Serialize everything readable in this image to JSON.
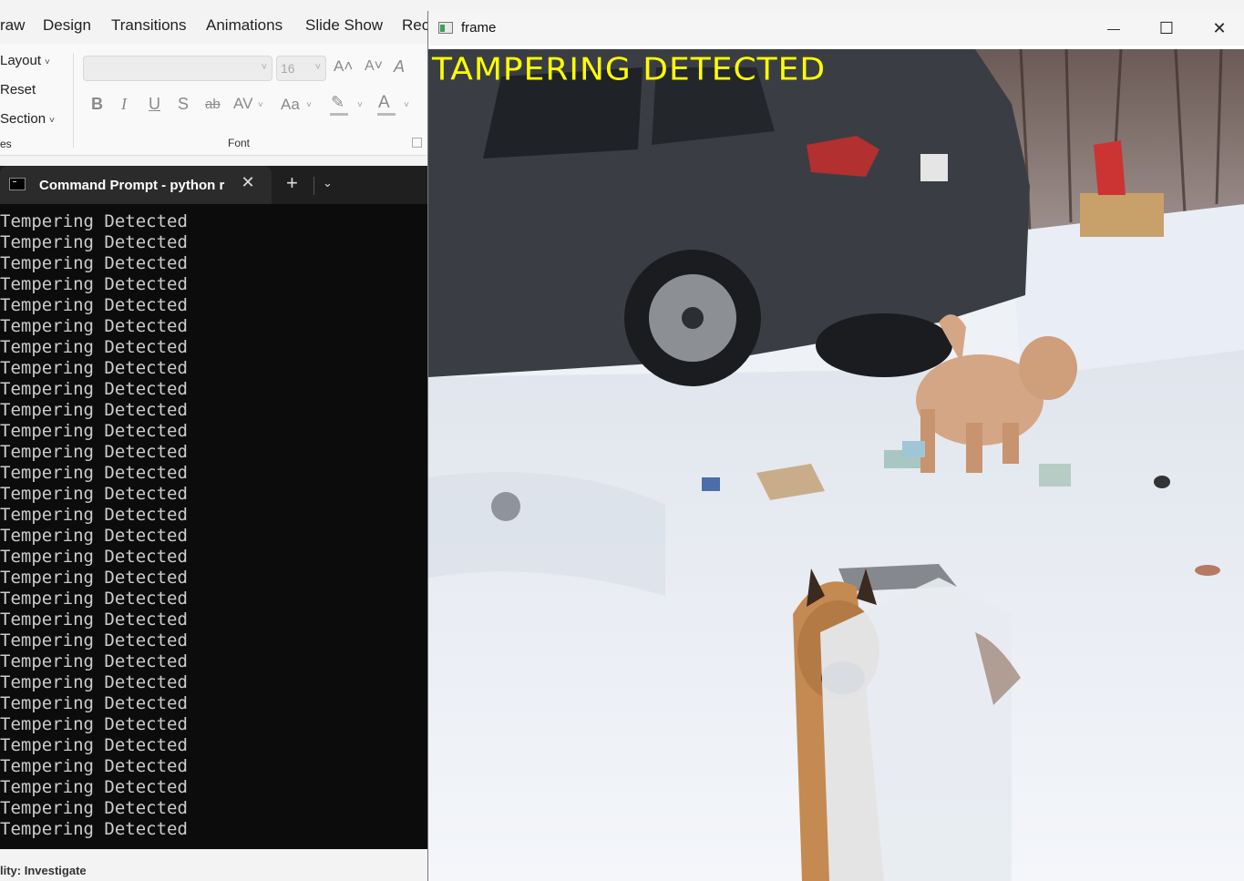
{
  "ppt": {
    "tabs": [
      "raw",
      "Design",
      "Transitions",
      "Animations",
      "Slide Show",
      "Rec"
    ],
    "slides_group": {
      "layout": "Layout",
      "reset": "Reset",
      "section": "Section",
      "group_label": "es"
    },
    "font_group": {
      "font_name": "",
      "font_size": "16",
      "grow_font": "A˄",
      "shrink_font": "A˅",
      "clear_formatting": "A",
      "bold": "B",
      "italic": "I",
      "underline": "U",
      "shadow": "S",
      "strikethrough": "ab",
      "char_spacing": "AV",
      "change_case": "Aa",
      "font_color": "A",
      "label": "Font"
    },
    "status": "lity: Investigate"
  },
  "terminal": {
    "tab_title": "Command Prompt - python r",
    "close_tab": "✕",
    "new_tab": "+",
    "tab_menu": "⌄",
    "output_lines": [
      "Tempering Detected",
      "Tempering Detected",
      "Tempering Detected",
      "Tempering Detected",
      "Tempering Detected",
      "Tempering Detected",
      "Tempering Detected",
      "Tempering Detected",
      "Tempering Detected",
      "Tempering Detected",
      "Tempering Detected",
      "Tempering Detected",
      "Tempering Detected",
      "Tempering Detected",
      "Tempering Detected",
      "Tempering Detected",
      "Tempering Detected",
      "Tempering Detected",
      "Tempering Detected",
      "Tempering Detected",
      "Tempering Detected",
      "Tempering Detected",
      "Tempering Detected",
      "Tempering Detected",
      "Tempering Detected",
      "Tempering Detected",
      "Tempering Detected",
      "Tempering Detected",
      "Tempering Detected",
      "Tempering Detected"
    ]
  },
  "frame_window": {
    "title": "frame",
    "minimize": "—",
    "maximize": "☐",
    "close": "✕",
    "overlay_text": "TAMPERING DETECTED",
    "overlay_color": "#ffff00"
  }
}
